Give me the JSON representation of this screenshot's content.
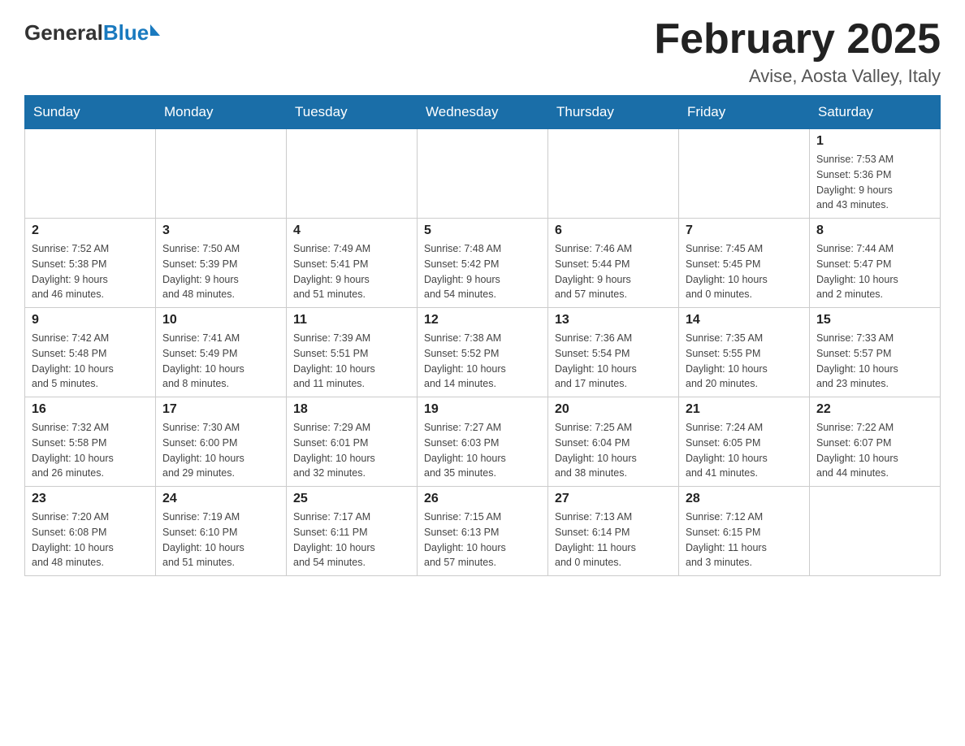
{
  "header": {
    "logo_general": "General",
    "logo_blue": "Blue",
    "month_title": "February 2025",
    "location": "Avise, Aosta Valley, Italy"
  },
  "weekdays": [
    "Sunday",
    "Monday",
    "Tuesday",
    "Wednesday",
    "Thursday",
    "Friday",
    "Saturday"
  ],
  "weeks": [
    [
      {
        "day": "",
        "info": ""
      },
      {
        "day": "",
        "info": ""
      },
      {
        "day": "",
        "info": ""
      },
      {
        "day": "",
        "info": ""
      },
      {
        "day": "",
        "info": ""
      },
      {
        "day": "",
        "info": ""
      },
      {
        "day": "1",
        "info": "Sunrise: 7:53 AM\nSunset: 5:36 PM\nDaylight: 9 hours\nand 43 minutes."
      }
    ],
    [
      {
        "day": "2",
        "info": "Sunrise: 7:52 AM\nSunset: 5:38 PM\nDaylight: 9 hours\nand 46 minutes."
      },
      {
        "day": "3",
        "info": "Sunrise: 7:50 AM\nSunset: 5:39 PM\nDaylight: 9 hours\nand 48 minutes."
      },
      {
        "day": "4",
        "info": "Sunrise: 7:49 AM\nSunset: 5:41 PM\nDaylight: 9 hours\nand 51 minutes."
      },
      {
        "day": "5",
        "info": "Sunrise: 7:48 AM\nSunset: 5:42 PM\nDaylight: 9 hours\nand 54 minutes."
      },
      {
        "day": "6",
        "info": "Sunrise: 7:46 AM\nSunset: 5:44 PM\nDaylight: 9 hours\nand 57 minutes."
      },
      {
        "day": "7",
        "info": "Sunrise: 7:45 AM\nSunset: 5:45 PM\nDaylight: 10 hours\nand 0 minutes."
      },
      {
        "day": "8",
        "info": "Sunrise: 7:44 AM\nSunset: 5:47 PM\nDaylight: 10 hours\nand 2 minutes."
      }
    ],
    [
      {
        "day": "9",
        "info": "Sunrise: 7:42 AM\nSunset: 5:48 PM\nDaylight: 10 hours\nand 5 minutes."
      },
      {
        "day": "10",
        "info": "Sunrise: 7:41 AM\nSunset: 5:49 PM\nDaylight: 10 hours\nand 8 minutes."
      },
      {
        "day": "11",
        "info": "Sunrise: 7:39 AM\nSunset: 5:51 PM\nDaylight: 10 hours\nand 11 minutes."
      },
      {
        "day": "12",
        "info": "Sunrise: 7:38 AM\nSunset: 5:52 PM\nDaylight: 10 hours\nand 14 minutes."
      },
      {
        "day": "13",
        "info": "Sunrise: 7:36 AM\nSunset: 5:54 PM\nDaylight: 10 hours\nand 17 minutes."
      },
      {
        "day": "14",
        "info": "Sunrise: 7:35 AM\nSunset: 5:55 PM\nDaylight: 10 hours\nand 20 minutes."
      },
      {
        "day": "15",
        "info": "Sunrise: 7:33 AM\nSunset: 5:57 PM\nDaylight: 10 hours\nand 23 minutes."
      }
    ],
    [
      {
        "day": "16",
        "info": "Sunrise: 7:32 AM\nSunset: 5:58 PM\nDaylight: 10 hours\nand 26 minutes."
      },
      {
        "day": "17",
        "info": "Sunrise: 7:30 AM\nSunset: 6:00 PM\nDaylight: 10 hours\nand 29 minutes."
      },
      {
        "day": "18",
        "info": "Sunrise: 7:29 AM\nSunset: 6:01 PM\nDaylight: 10 hours\nand 32 minutes."
      },
      {
        "day": "19",
        "info": "Sunrise: 7:27 AM\nSunset: 6:03 PM\nDaylight: 10 hours\nand 35 minutes."
      },
      {
        "day": "20",
        "info": "Sunrise: 7:25 AM\nSunset: 6:04 PM\nDaylight: 10 hours\nand 38 minutes."
      },
      {
        "day": "21",
        "info": "Sunrise: 7:24 AM\nSunset: 6:05 PM\nDaylight: 10 hours\nand 41 minutes."
      },
      {
        "day": "22",
        "info": "Sunrise: 7:22 AM\nSunset: 6:07 PM\nDaylight: 10 hours\nand 44 minutes."
      }
    ],
    [
      {
        "day": "23",
        "info": "Sunrise: 7:20 AM\nSunset: 6:08 PM\nDaylight: 10 hours\nand 48 minutes."
      },
      {
        "day": "24",
        "info": "Sunrise: 7:19 AM\nSunset: 6:10 PM\nDaylight: 10 hours\nand 51 minutes."
      },
      {
        "day": "25",
        "info": "Sunrise: 7:17 AM\nSunset: 6:11 PM\nDaylight: 10 hours\nand 54 minutes."
      },
      {
        "day": "26",
        "info": "Sunrise: 7:15 AM\nSunset: 6:13 PM\nDaylight: 10 hours\nand 57 minutes."
      },
      {
        "day": "27",
        "info": "Sunrise: 7:13 AM\nSunset: 6:14 PM\nDaylight: 11 hours\nand 0 minutes."
      },
      {
        "day": "28",
        "info": "Sunrise: 7:12 AM\nSunset: 6:15 PM\nDaylight: 11 hours\nand 3 minutes."
      },
      {
        "day": "",
        "info": ""
      }
    ]
  ]
}
